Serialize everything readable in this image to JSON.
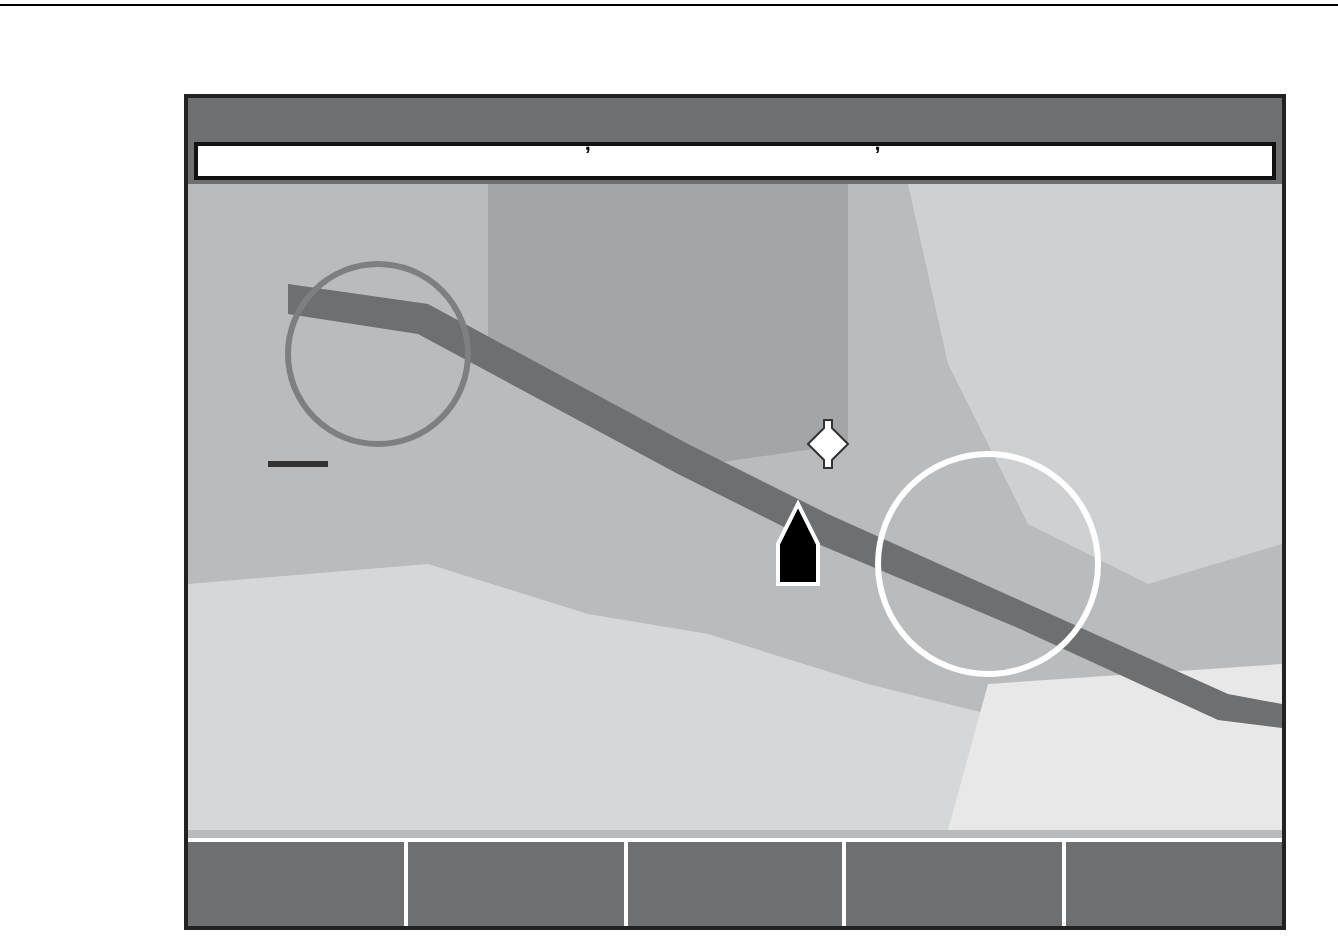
{
  "data_bar": {
    "marks": [
      "’",
      "’"
    ]
  },
  "softkeys": [
    {
      "kind": "blank"
    },
    {
      "kind": "blank"
    },
    {
      "kind": "blank"
    },
    {
      "kind": "blank"
    },
    {
      "kind": "blank"
    }
  ]
}
